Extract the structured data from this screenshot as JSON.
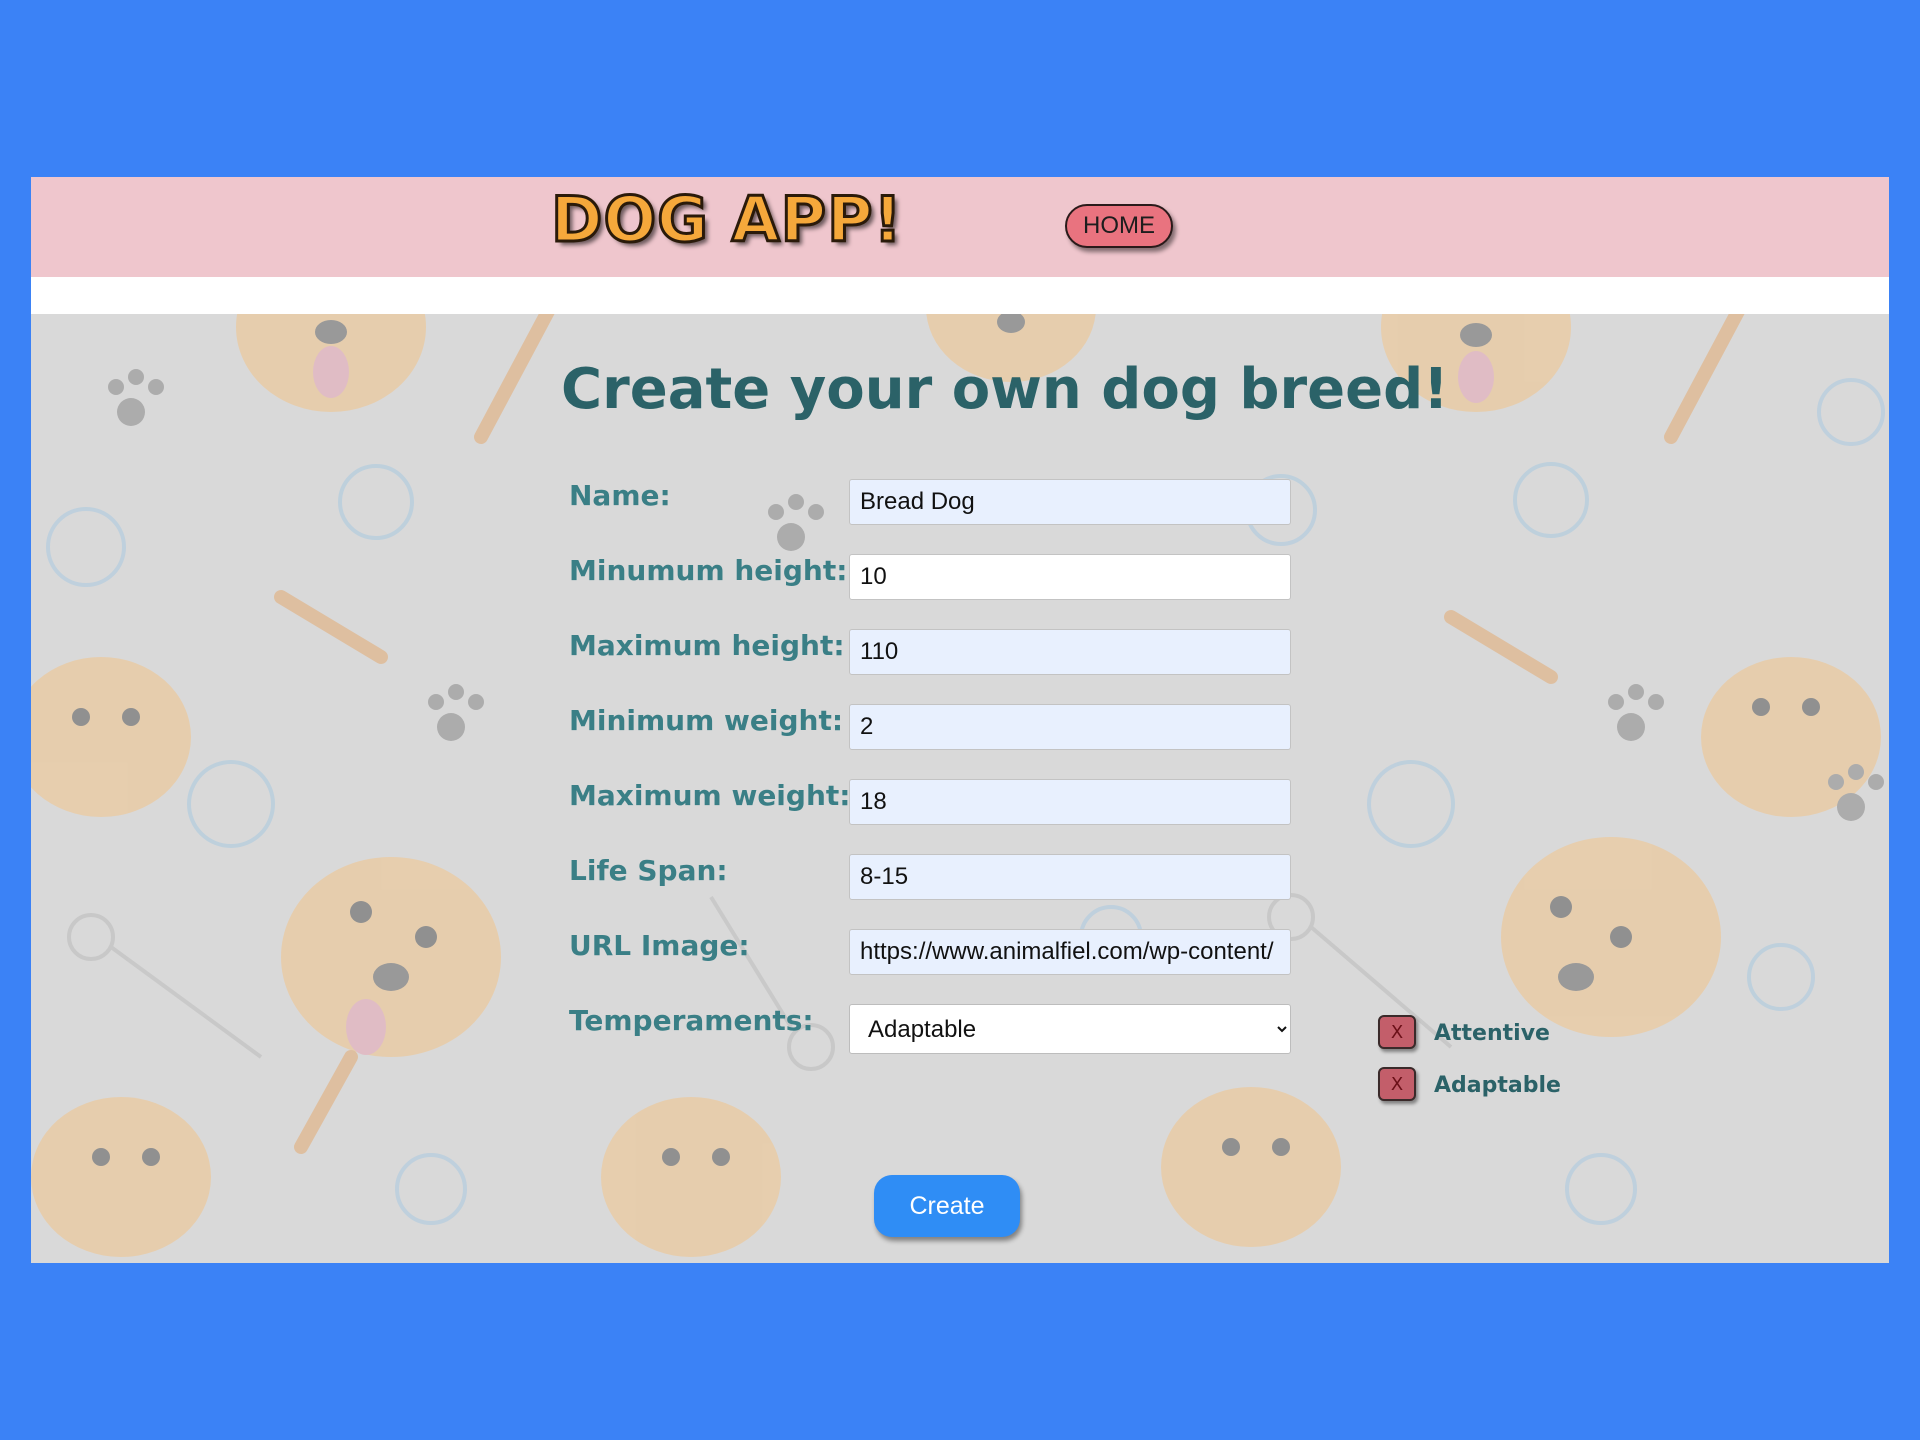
{
  "header": {
    "logo_text": "DOG APP!",
    "home_label": "HOME"
  },
  "page": {
    "title": "Create your own dog breed!"
  },
  "form": {
    "name_label": "Name:",
    "name_value": "Bread Dog",
    "min_height_label": "Minumum height:",
    "min_height_value": "10",
    "max_height_label": "Maximum height:",
    "max_height_value": "110",
    "min_weight_label": "Minimum weight:",
    "min_weight_value": "2",
    "max_weight_label": "Maximum weight:",
    "max_weight_value": "18",
    "life_span_label": "Life Span:",
    "life_span_value": "8-15",
    "url_label": "URL Image:",
    "url_value": "https://www.animalfiel.com/wp-content/",
    "temperaments_label": "Temperaments:",
    "temperaments_selected": "Adaptable"
  },
  "selected_temperaments": [
    {
      "label": "Attentive",
      "remove": "X"
    },
    {
      "label": "Adaptable",
      "remove": "X"
    }
  ],
  "actions": {
    "create_label": "Create"
  },
  "colors": {
    "outer_background": "#3b82f6",
    "header_background": "#efc6cd",
    "home_button": "#e9737f",
    "title_text": "#2b6268",
    "label_text": "#3a7f86",
    "create_button": "#2f8df5",
    "remove_button": "#c35e6a"
  }
}
